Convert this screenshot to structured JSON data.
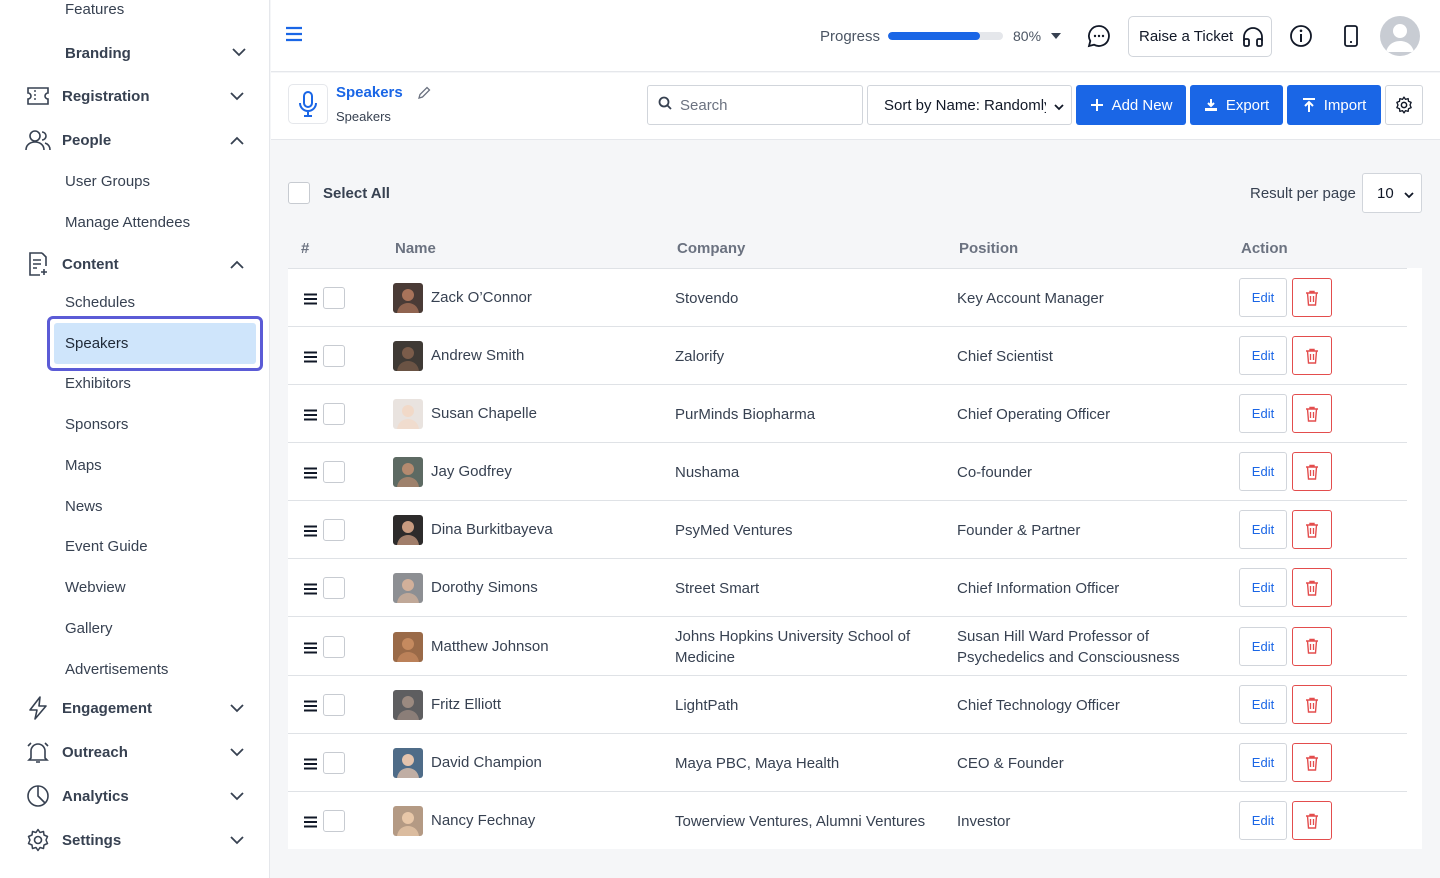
{
  "sidebar": {
    "features_label": "Features",
    "branding_label": "Branding",
    "sections": [
      {
        "label": "Registration"
      },
      {
        "label": "People"
      },
      {
        "label": "Content"
      },
      {
        "label": "Engagement"
      },
      {
        "label": "Outreach"
      },
      {
        "label": "Analytics"
      },
      {
        "label": "Settings"
      }
    ],
    "people_items": [
      "User Groups",
      "Manage Attendees"
    ],
    "content_items": [
      "Schedules",
      "Speakers",
      "Exhibitors",
      "Sponsors",
      "Maps",
      "News",
      "Event Guide",
      "Webview",
      "Gallery",
      "Advertisements"
    ],
    "active_item": "Speakers"
  },
  "topbar": {
    "progress_label": "Progress",
    "progress_value": 80,
    "progress_text": "80%",
    "ticket_label": "Raise a Ticket",
    "icons": [
      "menu-icon",
      "chat-icon",
      "headphones-icon",
      "info-icon",
      "phone-icon",
      "user-avatar-icon"
    ]
  },
  "page_header": {
    "title": "Speakers",
    "subtitle": "Speakers",
    "search_placeholder": "Search",
    "sort_value": "Sort by Name: Randomly",
    "add_new_label": "Add New",
    "export_label": "Export",
    "import_label": "Import"
  },
  "list": {
    "select_all_label": "Select All",
    "result_per_page_label": "Result per page",
    "result_per_page_value": "10",
    "columns": [
      "#",
      "Name",
      "Company",
      "Position",
      "Action"
    ],
    "edit_label": "Edit",
    "rows": [
      {
        "name": "Zack O’Connor",
        "company": "Stovendo",
        "position": "Key Account Manager"
      },
      {
        "name": "Andrew Smith",
        "company": "Zalorify",
        "position": "Chief Scientist"
      },
      {
        "name": "Susan Chapelle",
        "company": "PurMinds Biopharma",
        "position": "Chief Operating Officer"
      },
      {
        "name": "Jay Godfrey",
        "company": "Nushama",
        "position": "Co-founder"
      },
      {
        "name": "Dina Burkitbayeva",
        "company": "PsyMed Ventures",
        "position": "Founder & Partner"
      },
      {
        "name": "Dorothy Simons",
        "company": "Street Smart",
        "position": "Chief Information Officer"
      },
      {
        "name": "Matthew Johnson",
        "company": "Johns Hopkins University School of Medicine",
        "position": "Susan Hill Ward Professor of Psychedelics and Consciousness"
      },
      {
        "name": "Fritz Elliott",
        "company": "LightPath",
        "position": "Chief Technology Officer"
      },
      {
        "name": "David Champion",
        "company": "Maya PBC, Maya Health",
        "position": "CEO & Founder"
      },
      {
        "name": "Nancy Fechnay",
        "company": "Towerview Ventures, Alumni Ventures",
        "position": "Investor"
      }
    ]
  },
  "colors": {
    "accent": "#1a66e6",
    "active_bg": "#cfe5fb",
    "active_border": "#5b5bd6",
    "danger": "#e34d4d"
  }
}
